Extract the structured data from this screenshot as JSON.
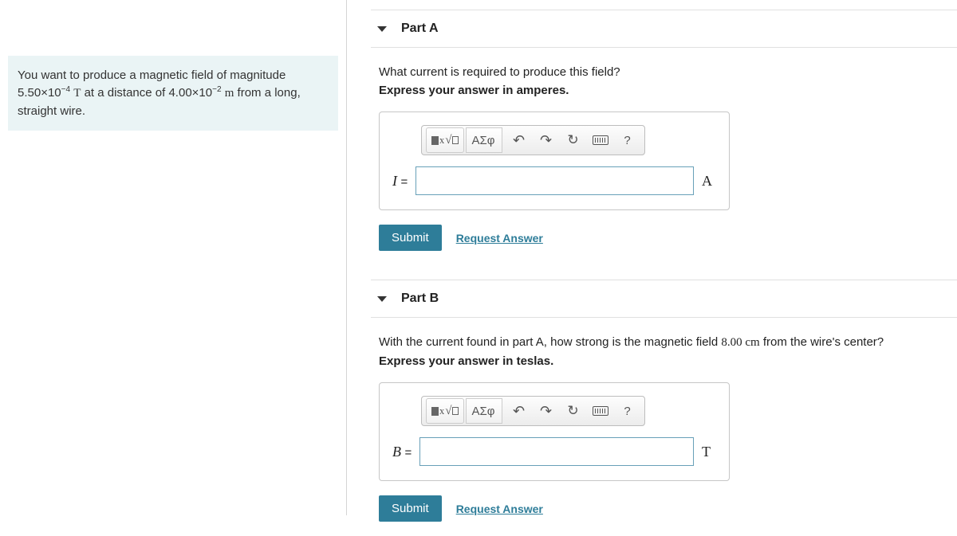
{
  "problem": {
    "line1_pre": "You want to produce a magnetic field of magnitude ",
    "mag_coeff": "5.50×10",
    "mag_exp": "−4",
    "mag_unit": " T",
    "dist_pre": " at a distance of ",
    "dist_coeff": "4.00×10",
    "dist_exp": "−2",
    "dist_unit": " m",
    "line1_post": " from a long, straight wire."
  },
  "partA": {
    "title": "Part A",
    "question": "What current is required to produce this field?",
    "instruction": "Express your answer in amperes.",
    "var": "I",
    "unit": "A",
    "submit": "Submit",
    "request": "Request Answer"
  },
  "partB": {
    "title": "Part B",
    "question_pre": "With the current found in part A, how strong is the magnetic field ",
    "distance": "8.00 cm",
    "question_post": " from the wire's center?",
    "instruction": "Express your answer in teslas.",
    "var": "B",
    "unit": "T",
    "submit": "Submit",
    "request": "Request Answer"
  },
  "toolbar": {
    "symbols": "ΑΣφ",
    "help": "?"
  }
}
